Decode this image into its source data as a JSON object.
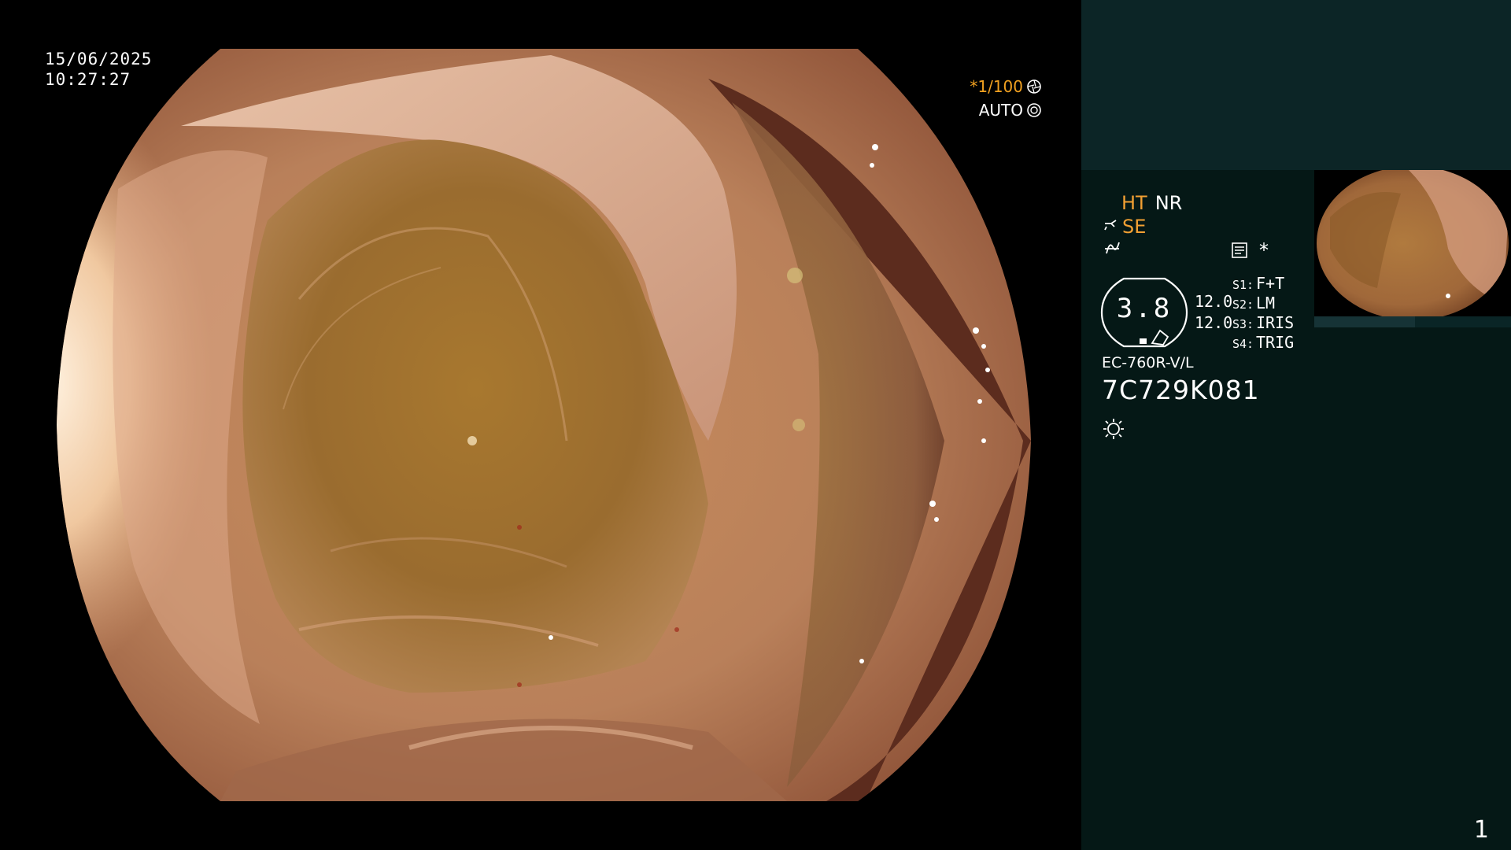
{
  "overlay": {
    "date": "15/06/2025",
    "time": "10:27:27",
    "shutter": "*1/100",
    "exposure_mode": "AUTO"
  },
  "panel": {
    "ht_label": "HT",
    "nr_label": "NR",
    "se_label": "SE",
    "asterisk": "*",
    "zoom_value": "3.8",
    "levels": [
      "12.0",
      "12.0"
    ],
    "switches": [
      {
        "key": "S1:",
        "value": "F+T"
      },
      {
        "key": "S2:",
        "value": "LM"
      },
      {
        "key": "S3:",
        "value": "IRIS"
      },
      {
        "key": "S4:",
        "value": "TRIG"
      }
    ],
    "scope_model": "EC-760R-V/L",
    "scope_serial": "7C729K081",
    "page_number": "1"
  },
  "colors": {
    "accent_orange": "#f2a033",
    "panel_bg": "#051816",
    "panel_top_bg": "#0c2526"
  },
  "icons": {
    "shutter": "shutter-wheel-icon",
    "auto": "iris-icon",
    "se_prefix": "scope-tip-icon",
    "squiggle": "freeze-curve-icon",
    "memo": "memo-card-icon",
    "light": "light-sun-icon"
  }
}
